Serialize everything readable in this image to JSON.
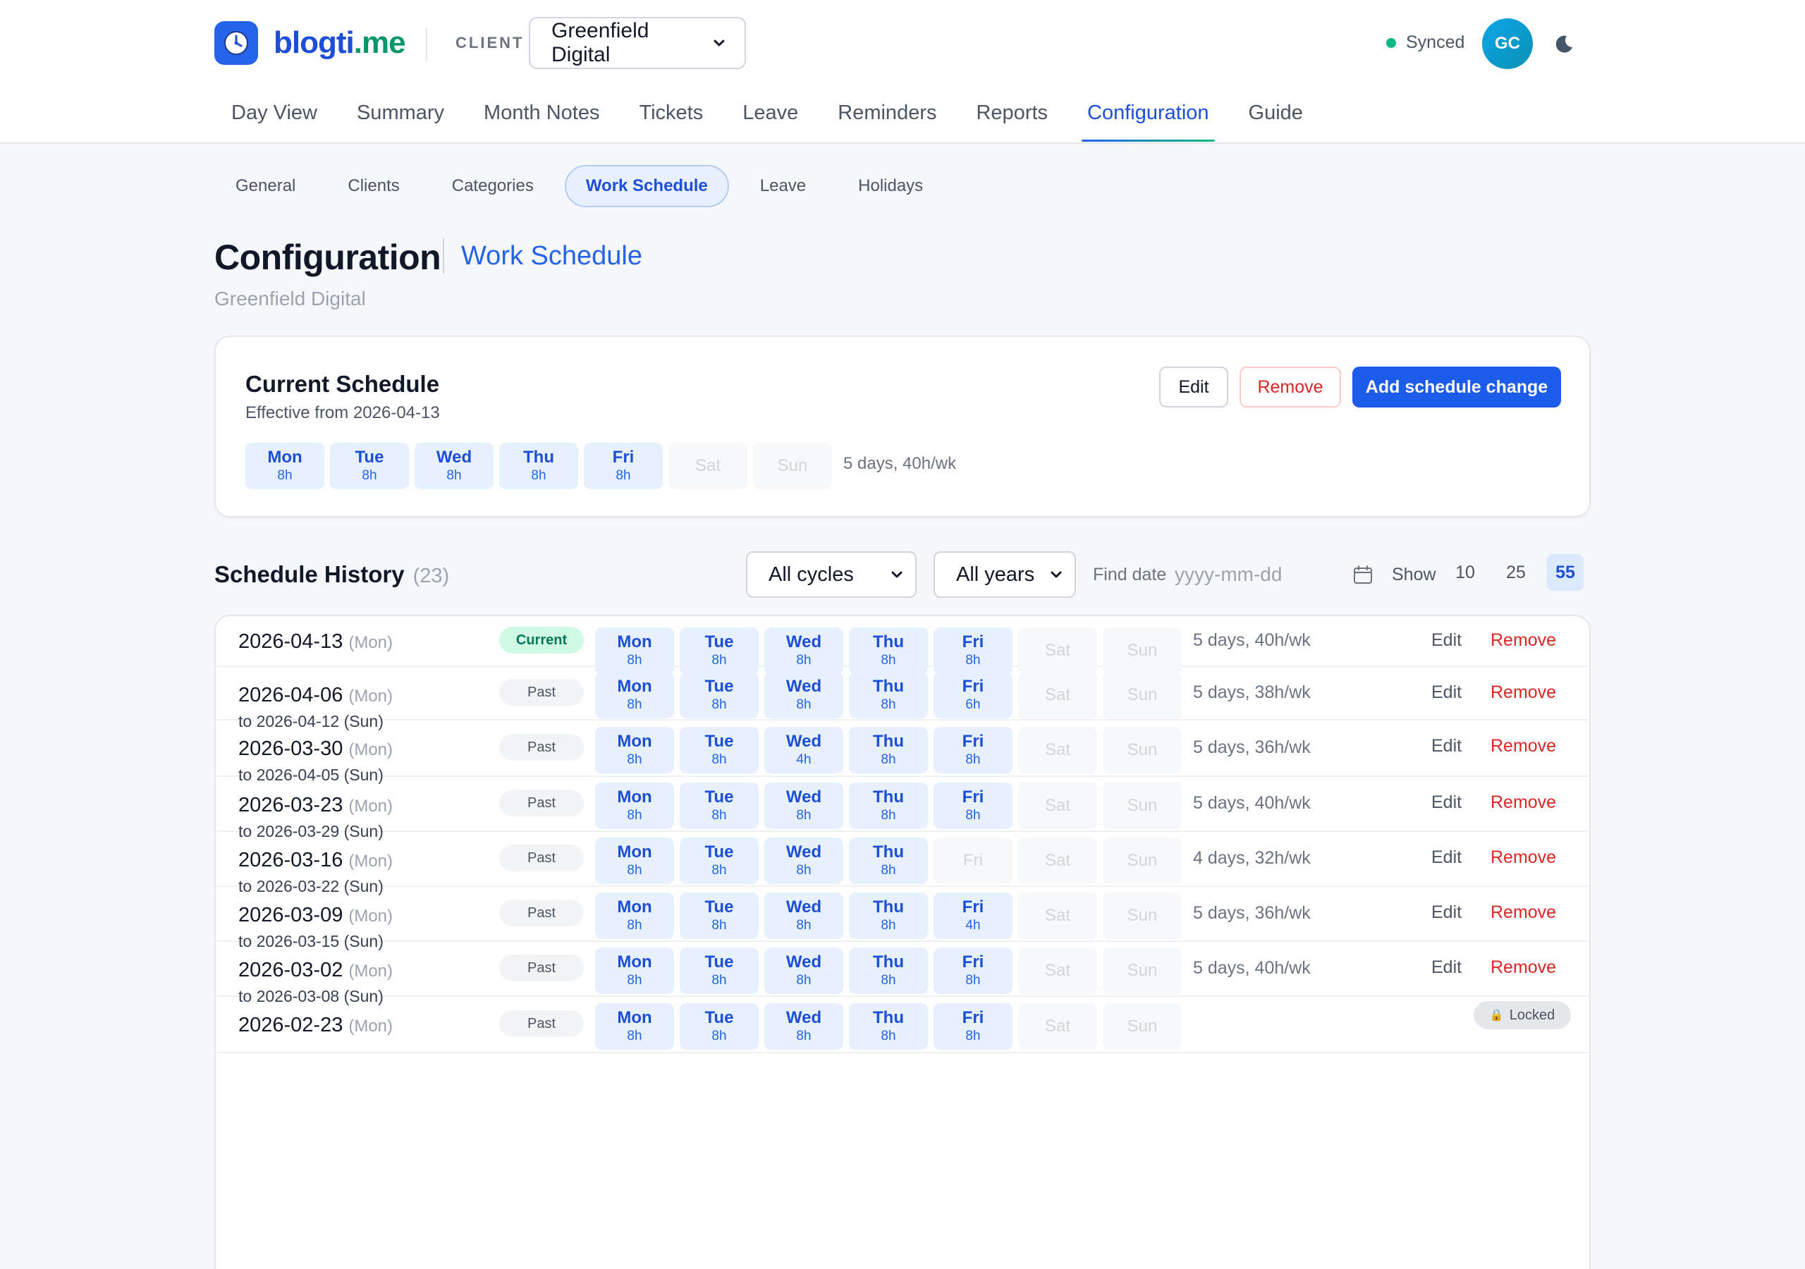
{
  "brand": {
    "name_part1": "blogti",
    "name_part2": ".me"
  },
  "client": {
    "label": "CLIENT",
    "selected": "Greenfield Digital"
  },
  "status": {
    "sync_text": "Synced",
    "avatar_initials": "GC"
  },
  "nav": {
    "items": [
      "Day View",
      "Summary",
      "Month Notes",
      "Tickets",
      "Leave",
      "Reminders",
      "Reports",
      "Configuration",
      "Guide"
    ],
    "active": "Configuration"
  },
  "subnav": {
    "items": [
      "General",
      "Clients",
      "Categories",
      "Work Schedule",
      "Leave",
      "Holidays"
    ],
    "active": "Work Schedule"
  },
  "page": {
    "title": "Configuration",
    "subtitle": "Work Schedule",
    "client_name": "Greenfield Digital"
  },
  "current": {
    "title": "Current Schedule",
    "effective": "Effective from 2026-04-13",
    "days": [
      {
        "name": "Mon",
        "hours": "8h"
      },
      {
        "name": "Tue",
        "hours": "8h"
      },
      {
        "name": "Wed",
        "hours": "8h"
      },
      {
        "name": "Thu",
        "hours": "8h"
      },
      {
        "name": "Fri",
        "hours": "8h"
      },
      {
        "name": "Sat",
        "hours": ""
      },
      {
        "name": "Sun",
        "hours": ""
      }
    ],
    "summary": "5 days, 40h/wk",
    "edit_label": "Edit",
    "remove_label": "Remove",
    "add_label": "Add schedule change"
  },
  "history": {
    "title": "Schedule History",
    "count": "(23)",
    "cycles_selected": "All cycles",
    "years_selected": "All years",
    "find_label": "Find date",
    "find_placeholder": "yyyy-mm-dd",
    "show_label": "Show",
    "page_sizes": [
      "10",
      "25",
      "55"
    ],
    "active_page_size": "55",
    "edit_label": "Edit",
    "remove_label": "Remove",
    "locked_label": "Locked",
    "rows": [
      {
        "start": "2026-04-13",
        "start_wd": "(Mon)",
        "end": "",
        "status": "Current",
        "days": [
          {
            "name": "Mon",
            "hours": "8h"
          },
          {
            "name": "Tue",
            "hours": "8h"
          },
          {
            "name": "Wed",
            "hours": "8h"
          },
          {
            "name": "Thu",
            "hours": "8h"
          },
          {
            "name": "Fri",
            "hours": "8h"
          },
          {
            "name": "Sat",
            "hours": ""
          },
          {
            "name": "Sun",
            "hours": ""
          }
        ],
        "summary": "5 days, 40h/wk"
      },
      {
        "start": "2026-04-06",
        "start_wd": "(Mon)",
        "end": "to 2026-04-12 (Sun)",
        "status": "Past",
        "days": [
          {
            "name": "Mon",
            "hours": "8h"
          },
          {
            "name": "Tue",
            "hours": "8h"
          },
          {
            "name": "Wed",
            "hours": "8h"
          },
          {
            "name": "Thu",
            "hours": "8h"
          },
          {
            "name": "Fri",
            "hours": "6h"
          },
          {
            "name": "Sat",
            "hours": ""
          },
          {
            "name": "Sun",
            "hours": ""
          }
        ],
        "summary": "5 days, 38h/wk"
      },
      {
        "start": "2026-03-30",
        "start_wd": "(Mon)",
        "end": "to 2026-04-05 (Sun)",
        "status": "Past",
        "days": [
          {
            "name": "Mon",
            "hours": "8h"
          },
          {
            "name": "Tue",
            "hours": "8h"
          },
          {
            "name": "Wed",
            "hours": "4h"
          },
          {
            "name": "Thu",
            "hours": "8h"
          },
          {
            "name": "Fri",
            "hours": "8h"
          },
          {
            "name": "Sat",
            "hours": ""
          },
          {
            "name": "Sun",
            "hours": ""
          }
        ],
        "summary": "5 days, 36h/wk"
      },
      {
        "start": "2026-03-23",
        "start_wd": "(Mon)",
        "end": "to 2026-03-29 (Sun)",
        "status": "Past",
        "days": [
          {
            "name": "Mon",
            "hours": "8h"
          },
          {
            "name": "Tue",
            "hours": "8h"
          },
          {
            "name": "Wed",
            "hours": "8h"
          },
          {
            "name": "Thu",
            "hours": "8h"
          },
          {
            "name": "Fri",
            "hours": "8h"
          },
          {
            "name": "Sat",
            "hours": ""
          },
          {
            "name": "Sun",
            "hours": ""
          }
        ],
        "summary": "5 days, 40h/wk"
      },
      {
        "start": "2026-03-16",
        "start_wd": "(Mon)",
        "end": "to 2026-03-22 (Sun)",
        "status": "Past",
        "days": [
          {
            "name": "Mon",
            "hours": "8h"
          },
          {
            "name": "Tue",
            "hours": "8h"
          },
          {
            "name": "Wed",
            "hours": "8h"
          },
          {
            "name": "Thu",
            "hours": "8h"
          },
          {
            "name": "Fri",
            "hours": ""
          },
          {
            "name": "Sat",
            "hours": ""
          },
          {
            "name": "Sun",
            "hours": ""
          }
        ],
        "summary": "4 days, 32h/wk"
      },
      {
        "start": "2026-03-09",
        "start_wd": "(Mon)",
        "end": "to 2026-03-15 (Sun)",
        "status": "Past",
        "days": [
          {
            "name": "Mon",
            "hours": "8h"
          },
          {
            "name": "Tue",
            "hours": "8h"
          },
          {
            "name": "Wed",
            "hours": "8h"
          },
          {
            "name": "Thu",
            "hours": "8h"
          },
          {
            "name": "Fri",
            "hours": "4h"
          },
          {
            "name": "Sat",
            "hours": ""
          },
          {
            "name": "Sun",
            "hours": ""
          }
        ],
        "summary": "5 days, 36h/wk"
      },
      {
        "start": "2026-03-02",
        "start_wd": "(Mon)",
        "end": "to 2026-03-08 (Sun)",
        "status": "Past",
        "days": [
          {
            "name": "Mon",
            "hours": "8h"
          },
          {
            "name": "Tue",
            "hours": "8h"
          },
          {
            "name": "Wed",
            "hours": "8h"
          },
          {
            "name": "Thu",
            "hours": "8h"
          },
          {
            "name": "Fri",
            "hours": "8h"
          },
          {
            "name": "Sat",
            "hours": ""
          },
          {
            "name": "Sun",
            "hours": ""
          }
        ],
        "summary": "5 days, 40h/wk"
      },
      {
        "start": "2026-02-23",
        "start_wd": "(Mon)",
        "end": "",
        "status": "Past",
        "days": [
          {
            "name": "Mon",
            "hours": "8h"
          },
          {
            "name": "Tue",
            "hours": "8h"
          },
          {
            "name": "Wed",
            "hours": "8h"
          },
          {
            "name": "Thu",
            "hours": "8h"
          },
          {
            "name": "Fri",
            "hours": "8h"
          },
          {
            "name": "Sat",
            "hours": ""
          },
          {
            "name": "Sun",
            "hours": ""
          }
        ],
        "summary": ""
      }
    ]
  },
  "colors": {
    "accent": "#2563eb",
    "brand_green": "#059669",
    "danger": "#dc2626",
    "success": "#10b981"
  },
  "icons": {
    "logo": "clock-icon",
    "theme": "moon-icon",
    "calendar": "calendar-icon",
    "lock": "lock-icon"
  }
}
